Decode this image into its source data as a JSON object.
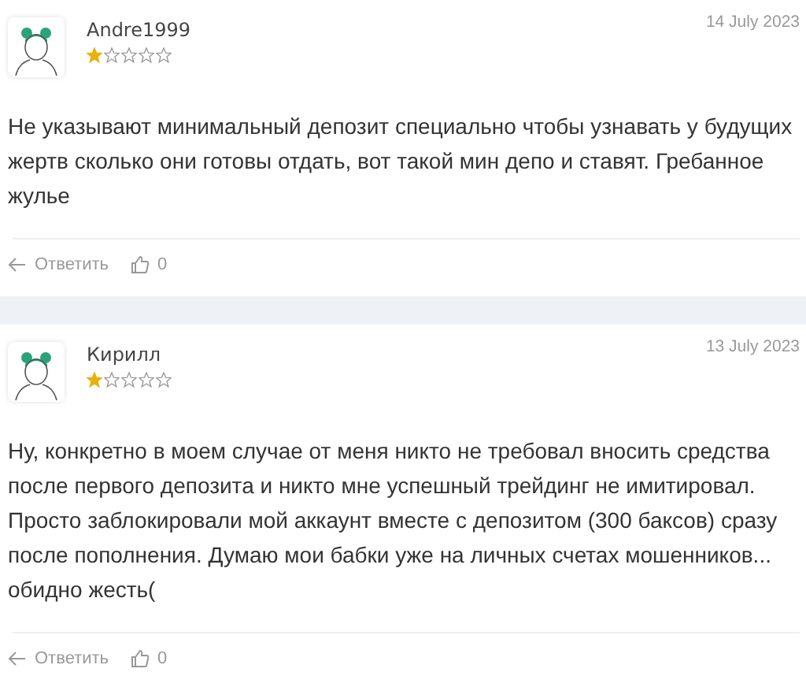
{
  "reviews": [
    {
      "author": "Andre1999",
      "stars": 1,
      "date": "14 July 2023",
      "text": "Не указывают минимальный депозит специально чтобы узнавать у будущих жертв сколько они готовы отдать, вот такой мин депо и ставят. Гребанное жулье",
      "reply": "Ответить",
      "likes": "0"
    },
    {
      "author": "Кирилл",
      "stars": 1,
      "date": "13 July 2023",
      "text": "Ну, конкретно в моем случае от меня никто не требовал вносить средства после первого депозита и никто мне успешный трейдинг не имитировал. Просто заблокировали мой аккаунт вместе с депозитом (300 баксов) сразу после пополнения. Думаю мои бабки уже на личных счетах мошенников... обидно жесть(",
      "reply": "Ответить",
      "likes": "0"
    }
  ]
}
